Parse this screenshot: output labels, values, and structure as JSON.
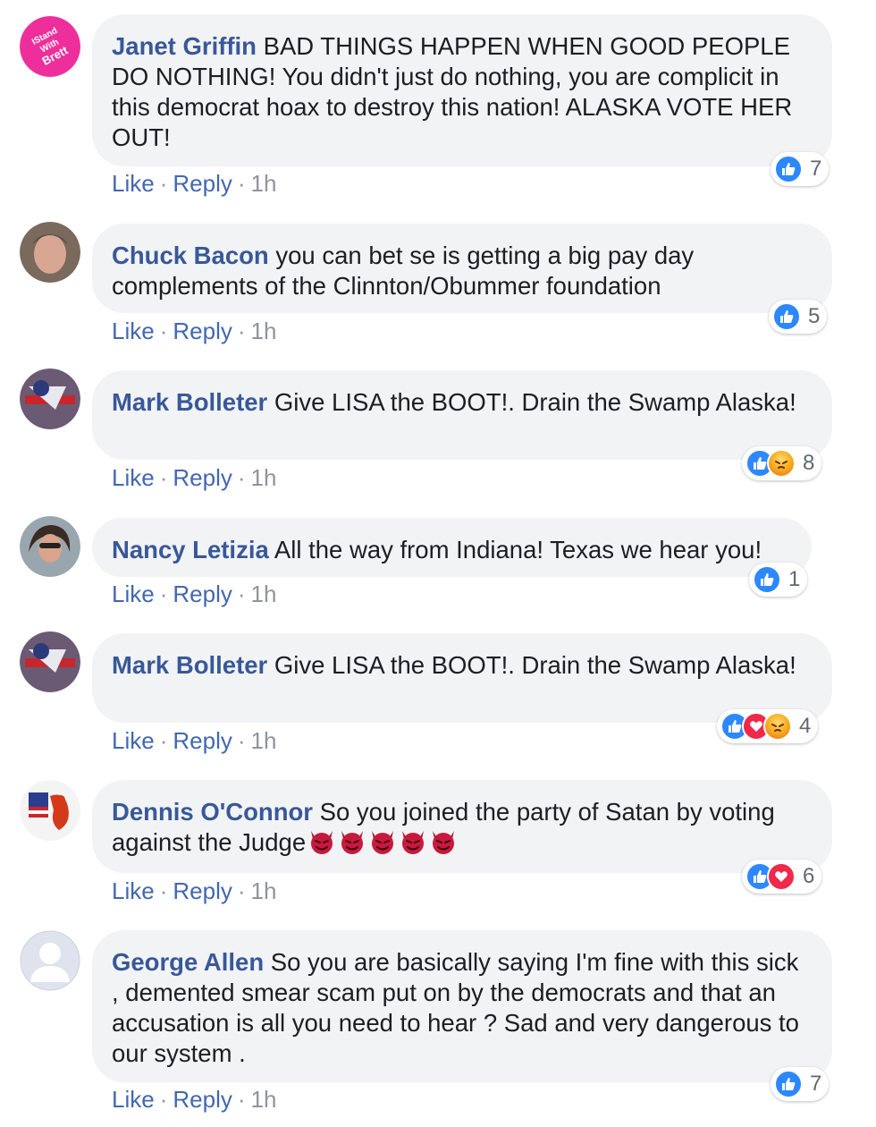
{
  "action_labels": {
    "like": "Like",
    "reply": "Reply",
    "separator": "·"
  },
  "comments": [
    {
      "name": "Janet Griffin",
      "text": " BAD THINGS HAPPEN WHEN GOOD PEOPLE DO NOTHING! You didn't just do nothing, you are complicit in this democrat hoax to destroy this nation! ALASKA VOTE HER OUT!",
      "time": "1h",
      "reactions": [
        "like"
      ],
      "reaction_count": "7",
      "avatar": "IStand With Brett"
    },
    {
      "name": "Chuck Bacon",
      "text": " you can bet se is getting a big pay day complements of the Clinnton/Obummer foundation",
      "time": "1h",
      "reactions": [
        "like"
      ],
      "reaction_count": "5",
      "avatar": ""
    },
    {
      "name": "Mark Bolleter",
      "text": " Give LISA the BOOT!. Drain the Swamp Alaska!",
      "time": "1h",
      "reactions": [
        "like",
        "angry"
      ],
      "reaction_count": "8",
      "avatar": ""
    },
    {
      "name": "Nancy Letizia",
      "text": " All the way from Indiana! Texas we hear you!",
      "time": "1h",
      "reactions": [
        "like"
      ],
      "reaction_count": "1",
      "avatar": ""
    },
    {
      "name": "Mark Bolleter",
      "text": " Give LISA the BOOT!. Drain the Swamp Alaska!",
      "time": "1h",
      "reactions": [
        "like",
        "love",
        "angry"
      ],
      "reaction_count": "4",
      "avatar": ""
    },
    {
      "name": "Dennis O'Connor",
      "text": " So you joined the party of Satan by voting against the Judge",
      "time": "1h",
      "reactions": [
        "like",
        "love"
      ],
      "reaction_count": "6",
      "emoji_trail": "smiling-face-with-horns x5",
      "avatar": ""
    },
    {
      "name": "George Allen",
      "text": " So you are basically saying I'm fine with this sick , demented smear scam put on by the democrats and that an accusation is all you need to hear ? Sad and very dangerous to our system .",
      "time": "1h",
      "reactions": [
        "like"
      ],
      "reaction_count": "7",
      "avatar": ""
    }
  ],
  "colors": {
    "name": "#385898",
    "link": "#4267b2",
    "bubble": "#f2f3f5",
    "like": "#2d88ff",
    "love": "#f0284a",
    "angry": "#f7b125"
  }
}
